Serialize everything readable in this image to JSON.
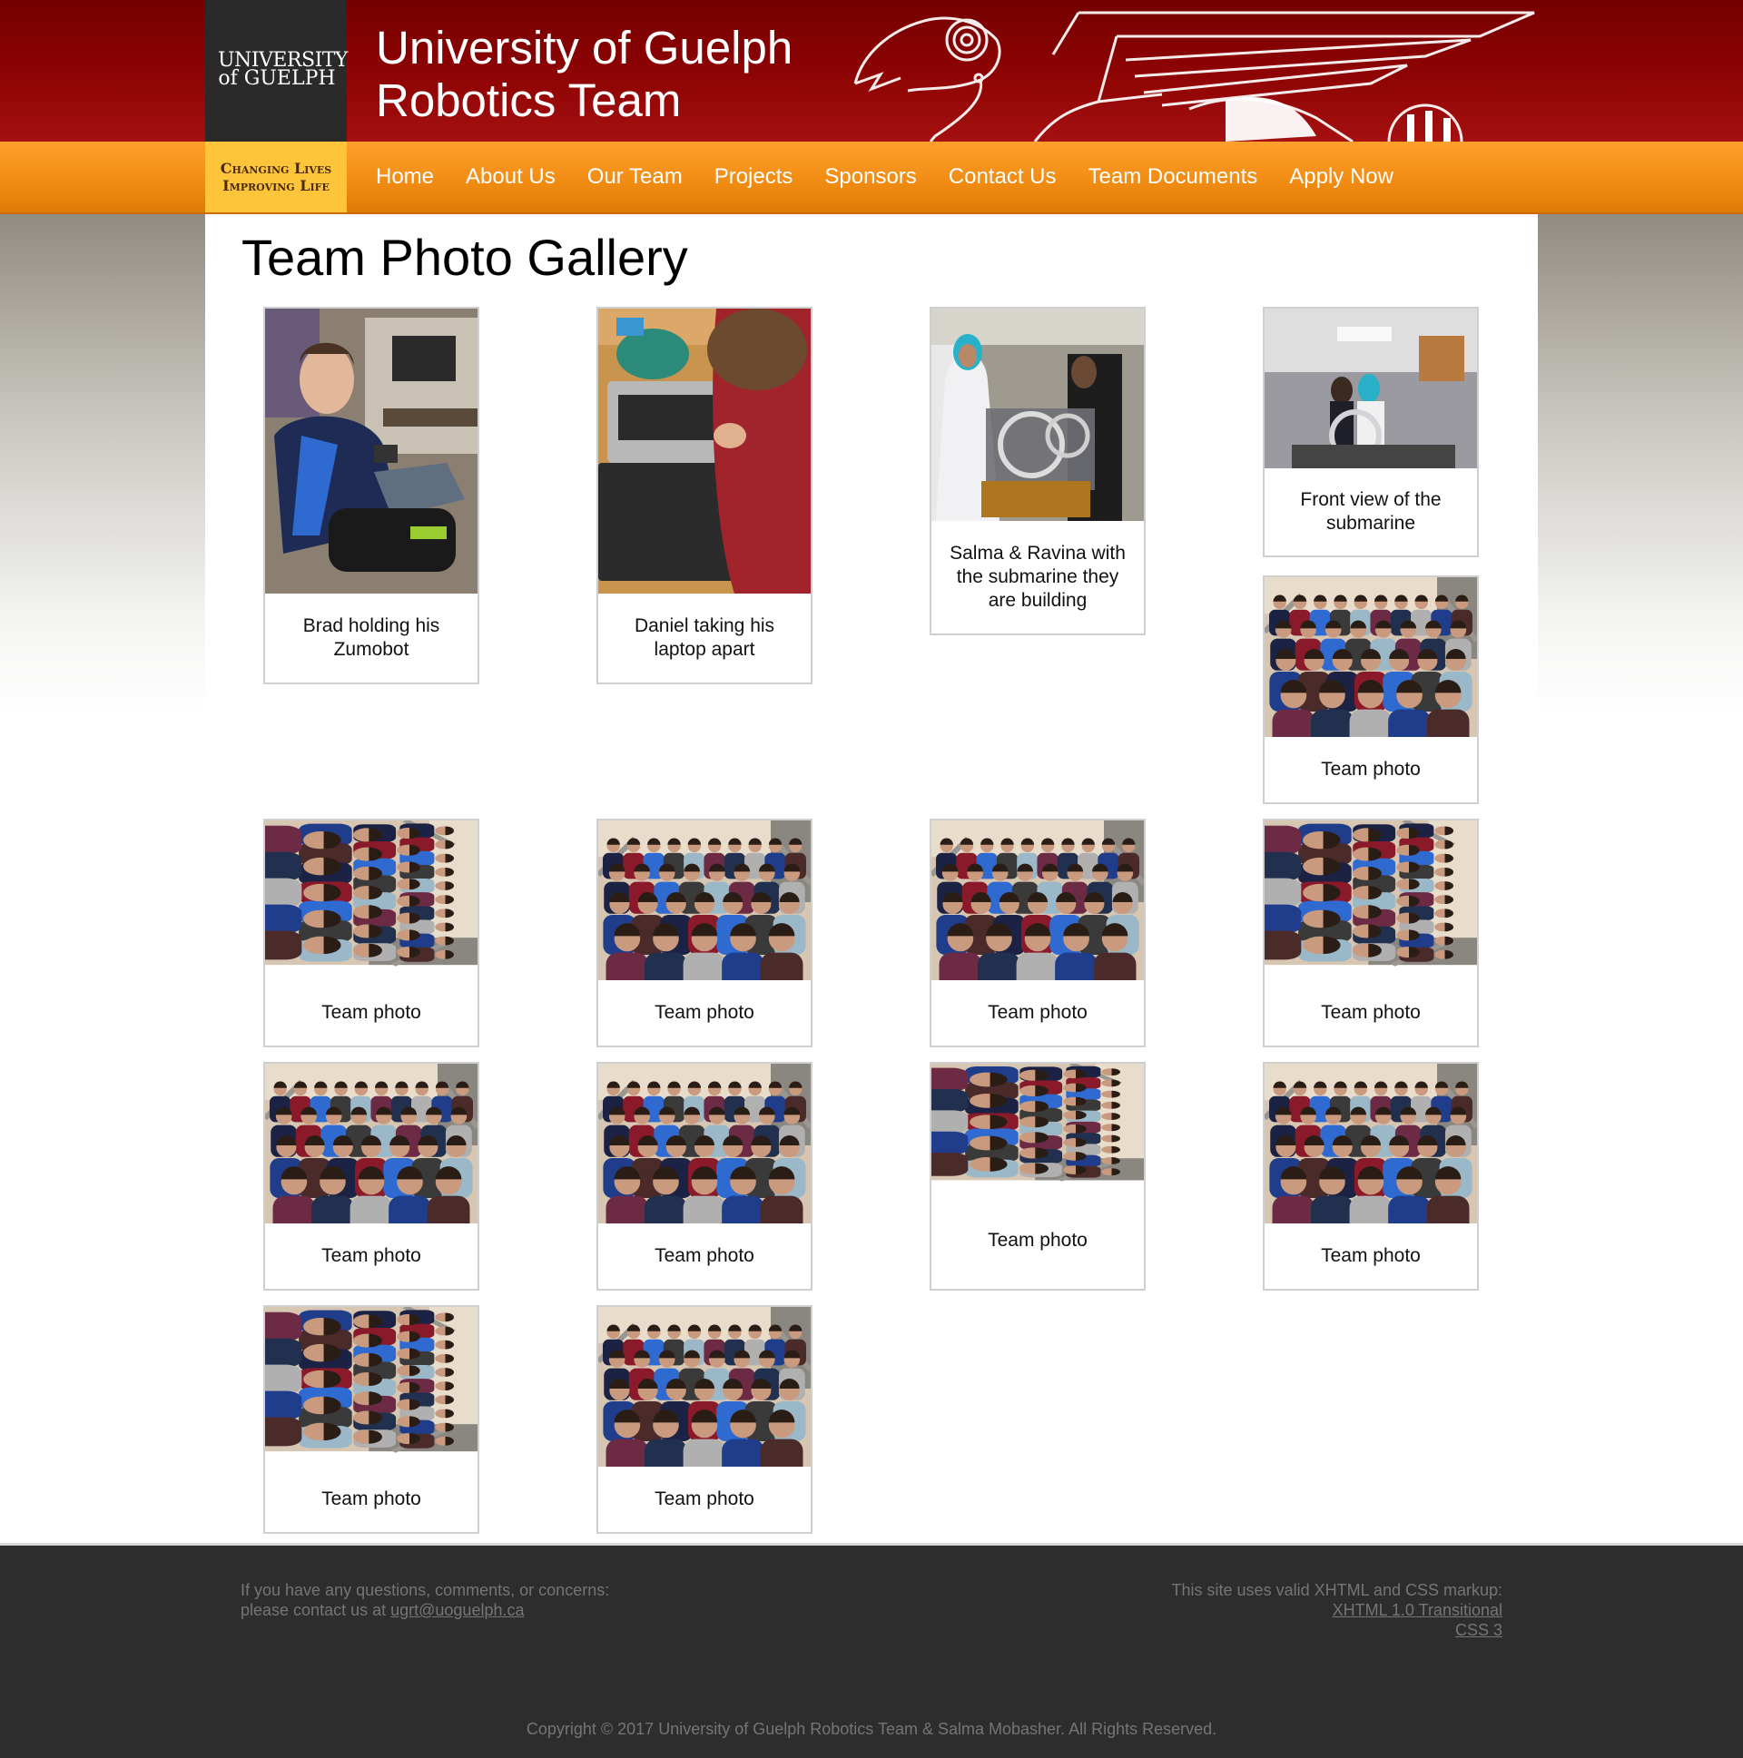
{
  "header": {
    "logo_line1": "UNIVERSITY",
    "logo_line2": "of GUELPH",
    "title_line1": "University of Guelph",
    "title_line2": "Robotics Team",
    "tagline_line1": "Changing Lives",
    "tagline_line2": "Improving Life"
  },
  "nav": [
    "Home",
    "About Us",
    "Our Team",
    "Projects",
    "Sponsors",
    "Contact Us",
    "Team Documents",
    "Apply Now"
  ],
  "page": {
    "title": "Team Photo Gallery"
  },
  "gallery": [
    {
      "caption": "Brad holding his Zumobot"
    },
    {
      "caption": "Daniel taking his laptop apart"
    },
    {
      "caption": "Salma & Ravina with the submarine they are building"
    },
    {
      "caption": "Front view of the submarine"
    },
    {
      "caption": "Team photo"
    },
    {
      "caption": "Team photo"
    },
    {
      "caption": "Team photo"
    },
    {
      "caption": "Team photo"
    },
    {
      "caption": "Team photo"
    },
    {
      "caption": "Team photo"
    },
    {
      "caption": "Team photo"
    },
    {
      "caption": "Team photo"
    },
    {
      "caption": "Team photo"
    },
    {
      "caption": "Team photo"
    },
    {
      "caption": "Team photo"
    }
  ],
  "footer": {
    "left_line1": "If you have any questions, comments, or concerns:",
    "left_prefix": "please contact us at ",
    "email": "ugrt@uoguelph.ca",
    "right_line1": "This site uses valid XHTML and CSS markup:",
    "xhtml_link": "XHTML 1.0 Transitional",
    "css_link": "CSS 3",
    "copyright": "Copyright © 2017 University of Guelph Robotics Team & Salma Mobasher. All Rights Reserved."
  },
  "colors": {
    "header_red": "#8f0404",
    "nav_orange": "#f08b12",
    "tagline_yellow": "#ffc53a",
    "footer_dark": "#2d2d2d"
  }
}
